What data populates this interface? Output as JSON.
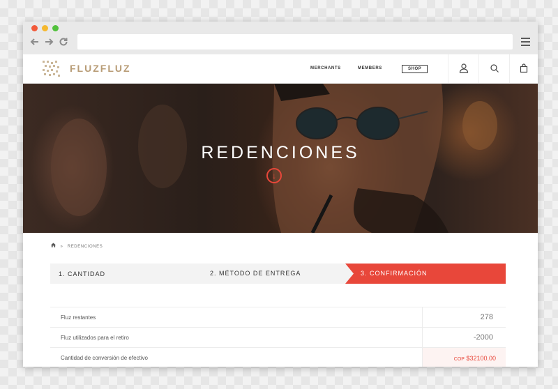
{
  "browser": {
    "url": "",
    "icons": [
      "back-arrow-icon",
      "forward-arrow-icon",
      "reload-icon",
      "hamburger-menu-icon"
    ]
  },
  "header": {
    "logo_text": "FLUZFLUZ",
    "nav": {
      "merchants": "MERCHANTS",
      "members": "MEMBERS",
      "shop": "SHOP"
    },
    "icons": [
      "user-icon",
      "search-icon",
      "shopping-bag-icon"
    ]
  },
  "hero": {
    "title": "REDENCIONES",
    "arrow_icon": "arrow-down-circle-icon"
  },
  "breadcrumb": {
    "home_icon": "home-icon",
    "separator": "»",
    "current": "REDENCIONES"
  },
  "steps": [
    {
      "label": "1. CANTIDAD",
      "active": false
    },
    {
      "label": "2. MÉTODO DE ENTREGA",
      "active": false
    },
    {
      "label": "3. CONFIRMACIÓN",
      "active": true
    }
  ],
  "table": {
    "rows": [
      {
        "label": "Fluz restantes",
        "value": "278"
      },
      {
        "label": "Fluz utilizados para el retiro",
        "value": "-2000"
      },
      {
        "label": "Cantidad de conversión de efectivo",
        "currency": "COP",
        "value": "$32100.00"
      }
    ]
  },
  "colors": {
    "accent": "#e8473a",
    "logo": "#b89c76",
    "window_dots": [
      "#f25a3a",
      "#f5b82e",
      "#52c13c"
    ]
  }
}
